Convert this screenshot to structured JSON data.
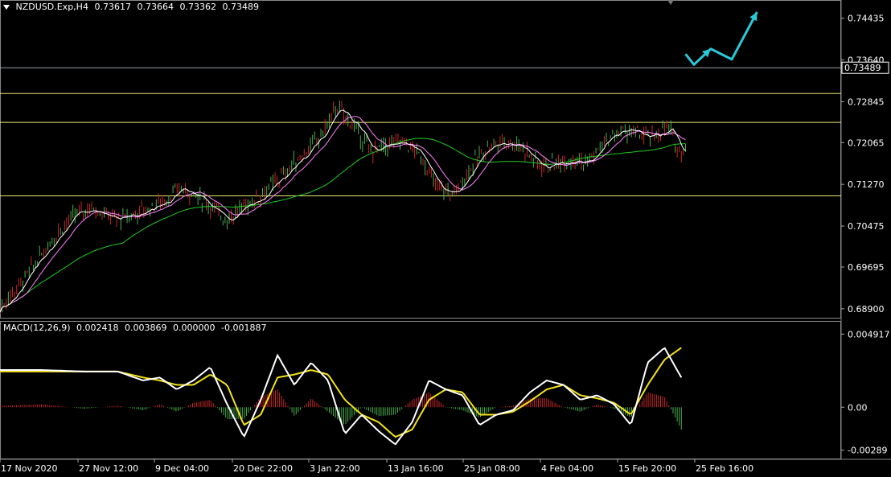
{
  "header": {
    "symbol": "NZDUSD.Exp,H4",
    "open": "0.73617",
    "high": "0.73664",
    "low": "0.73362",
    "close": "0.73489"
  },
  "macd_header": {
    "name": "MACD(12,26,9)",
    "v1": "0.002418",
    "v2": "0.003869",
    "v3": "0.000000",
    "v4": "-0.001887"
  },
  "colors": {
    "background": "#000000",
    "bull": "#4caf50",
    "bear": "#c62828",
    "ma_fast": "#ffffff",
    "ma_mid": "#ff80ff",
    "ma_slow": "#22cc22",
    "level_line": "#e8e870",
    "forecast_arrow": "#2bc8d8",
    "macd_line": "#ffffff",
    "signal_line": "#f2e21a"
  },
  "chart_data": [
    {
      "type": "line",
      "title": "NZDUSD.Exp,H4",
      "y_ticks": [
        "0.74435",
        "0.73640",
        "0.72845",
        "0.72065",
        "0.71270",
        "0.70475",
        "0.69695",
        "0.68900"
      ],
      "current_price_label": "0.73489",
      "x_ticks": [
        "17 Nov 2020",
        "27 Nov 12:00",
        "9 Dec 04:00",
        "20 Dec 22:00",
        "3 Jan 22:00",
        "13 Jan 16:00",
        "25 Jan 08:00",
        "4 Feb 04:00",
        "15 Feb 20:00",
        "25 Feb 16:00"
      ],
      "ylim": [
        0.6873,
        0.7478
      ],
      "horizontal_levels": [
        0.7349,
        0.73,
        0.7245,
        0.7105
      ],
      "price_path_x": [
        0,
        3,
        5,
        7,
        9,
        11,
        12.5,
        14,
        16,
        18,
        20,
        21.5,
        23,
        25,
        27,
        29,
        30.5,
        32,
        34,
        36,
        38,
        40,
        42,
        44,
        46,
        48,
        50,
        52,
        54,
        56,
        58,
        60,
        62,
        64,
        66,
        67.5,
        68.5,
        69.5,
        70.5,
        72,
        74,
        75.5,
        77,
        78.5,
        79.5,
        80.5,
        81,
        81.5
      ],
      "price_path_y": [
        0.689,
        0.695,
        0.6995,
        0.704,
        0.707,
        0.7085,
        0.707,
        0.706,
        0.707,
        0.7085,
        0.71,
        0.712,
        0.711,
        0.7085,
        0.706,
        0.7085,
        0.71,
        0.712,
        0.715,
        0.7185,
        0.7215,
        0.7275,
        0.724,
        0.719,
        0.72,
        0.721,
        0.718,
        0.712,
        0.711,
        0.716,
        0.72,
        0.721,
        0.72,
        0.7165,
        0.7165,
        0.7175,
        0.718,
        0.7165,
        0.718,
        0.721,
        0.723,
        0.7225,
        0.7215,
        0.7225,
        0.7235,
        0.7195,
        0.719,
        0.72
      ],
      "forecast_arrow_path": [
        [
          81.5,
          0.7375
        ],
        [
          82.5,
          0.7355
        ],
        [
          84.5,
          0.7385
        ],
        [
          87,
          0.7365
        ],
        [
          90,
          0.7455
        ]
      ],
      "x_range": [
        0,
        100
      ]
    },
    {
      "type": "bar",
      "title": "MACD(12,26,9)",
      "y_ticks": [
        "0.004917",
        "0.00",
        "-0.00289"
      ],
      "ylim": [
        -0.0035,
        0.0058
      ],
      "macd_x": [
        0,
        5,
        10,
        14,
        17,
        19,
        21,
        23,
        25,
        27,
        29,
        31,
        33,
        35,
        37,
        39,
        41,
        43,
        45,
        47,
        49,
        51,
        53,
        55,
        57,
        59,
        61,
        63,
        65,
        67,
        69,
        71,
        73,
        75,
        77,
        79,
        81
      ],
      "macd_y": [
        0.0025,
        0.0025,
        0.0024,
        0.0024,
        0.0018,
        0.002,
        0.0012,
        0.0018,
        0.0027,
        0.0002,
        -0.002,
        0.0005,
        0.0035,
        0.0015,
        0.003,
        0.0018,
        -0.0018,
        -0.0005,
        -0.0016,
        -0.0025,
        -0.001,
        0.0018,
        0.0012,
        0.0008,
        -0.0012,
        -0.0005,
        -0.0002,
        0.001,
        0.0018,
        0.0015,
        0.0005,
        0.0008,
        0.0002,
        -0.0012,
        0.003,
        0.004,
        0.002
      ],
      "signal_y": [
        0.0024,
        0.0024,
        0.0024,
        0.0024,
        0.002,
        0.0018,
        0.0015,
        0.0015,
        0.0022,
        0.0015,
        -0.0012,
        -0.0005,
        0.002,
        0.0022,
        0.0025,
        0.0022,
        0.0005,
        -0.0005,
        -0.001,
        -0.002,
        -0.0015,
        0.0005,
        0.0012,
        0.001,
        -0.0005,
        -0.0005,
        -0.0003,
        0.0004,
        0.0012,
        0.0015,
        0.0008,
        0.0006,
        0.0003,
        -0.0005,
        0.0015,
        0.0032,
        0.004
      ],
      "histogram": [
        0.0001,
        0.0002,
        -0.0001,
        0.0001,
        -0.0002,
        0.0002,
        -0.0003,
        0.0003,
        0.0005,
        -0.0008,
        -0.0008,
        0.0007,
        0.0012,
        -0.0006,
        0.0006,
        -0.0003,
        -0.0012,
        0.0,
        -0.0006,
        -0.0005,
        0.0005,
        0.001,
        0.0,
        -0.0002,
        -0.0007,
        0.0,
        0.0001,
        0.0006,
        0.0006,
        0.0,
        -0.0003,
        0.0002,
        -0.0001,
        -0.0007,
        0.001,
        0.0007,
        -0.0015
      ]
    }
  ]
}
